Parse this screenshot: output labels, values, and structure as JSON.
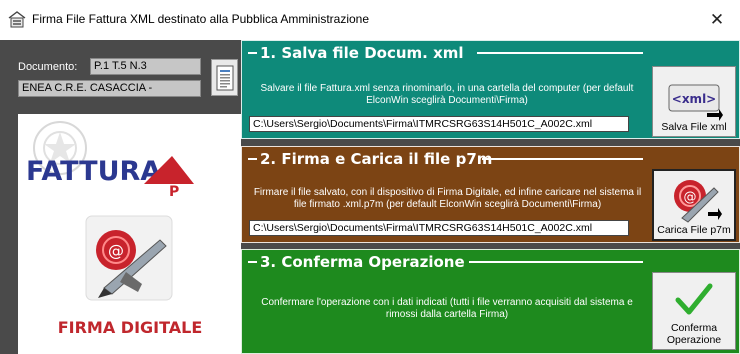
{
  "window": {
    "title": "Firma File Fattura XML destinato alla  Pubblica Amministrazione",
    "close_glyph": "✕"
  },
  "document": {
    "label": "Documento:",
    "value": "P.1  T.5  N.3",
    "supplier": "ENEA C.R.E. CASACCIA -"
  },
  "logos": {
    "fattura_text": "FATTURA",
    "firma_text": "FIRMA DIGITALE"
  },
  "steps": [
    {
      "title": "1. Salva file Docum. xml",
      "description": "Salvare il file Fattura.xml senza rinominarlo, in una cartella del computer (per default ElconWin sceglirà Documenti\\Firma)",
      "path": "C:\\Users\\Sergio\\Documents\\Firma\\ITMRCSRG63S14H501C_A002C.xml",
      "button": "Salva File xml",
      "icon_text": "<xml>"
    },
    {
      "title": "2. Firma e Carica il file p7m",
      "description": "Firmare il file salvato, con il dispositivo di Firma Digitale, ed infine caricare nel sistema il file firmato .xml.p7m  (per default ElconWin sceglirà Documenti\\Firma)",
      "path": "C:\\Users\\Sergio\\Documents\\Firma\\ITMRCSRG63S14H501C_A002C.xml",
      "button": "Carica File p7m"
    },
    {
      "title": "3. Conferma Operazione",
      "description": "Confermare l'operazione con i dati indicati (tutti i file verranno acquisiti dal sistema e rimossi dalla cartella Firma)",
      "button": "Conferma Operazione"
    }
  ],
  "colors": {
    "step1": "#0e8a7a",
    "step2": "#7c4414",
    "step3": "#1e8a1e",
    "background": "#4a4a4a"
  }
}
